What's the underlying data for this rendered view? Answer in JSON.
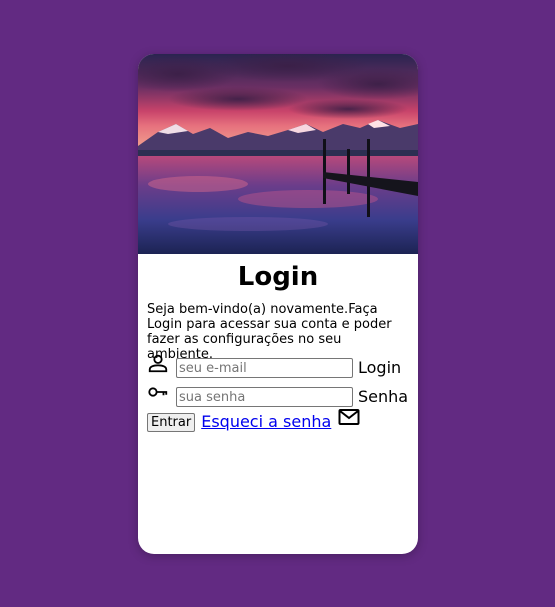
{
  "login": {
    "title": "Login",
    "intro": "Seja bem-vindo(a) novamente.Faça Login para acessar sua conta e poder fazer as configurações no seu ambiente.",
    "email": {
      "placeholder": "seu e-mail",
      "value": "",
      "label": "Login",
      "icon": "user-icon"
    },
    "password": {
      "placeholder": "sua senha",
      "value": "",
      "label": "Senha",
      "icon": "key-icon"
    },
    "submit_label": "Entrar",
    "forgot_label": "Esqueci a senha",
    "forgot_icon": "mail-icon"
  },
  "colors": {
    "background": "#622a82",
    "card": "#ffffff",
    "link": "#0000ee"
  }
}
